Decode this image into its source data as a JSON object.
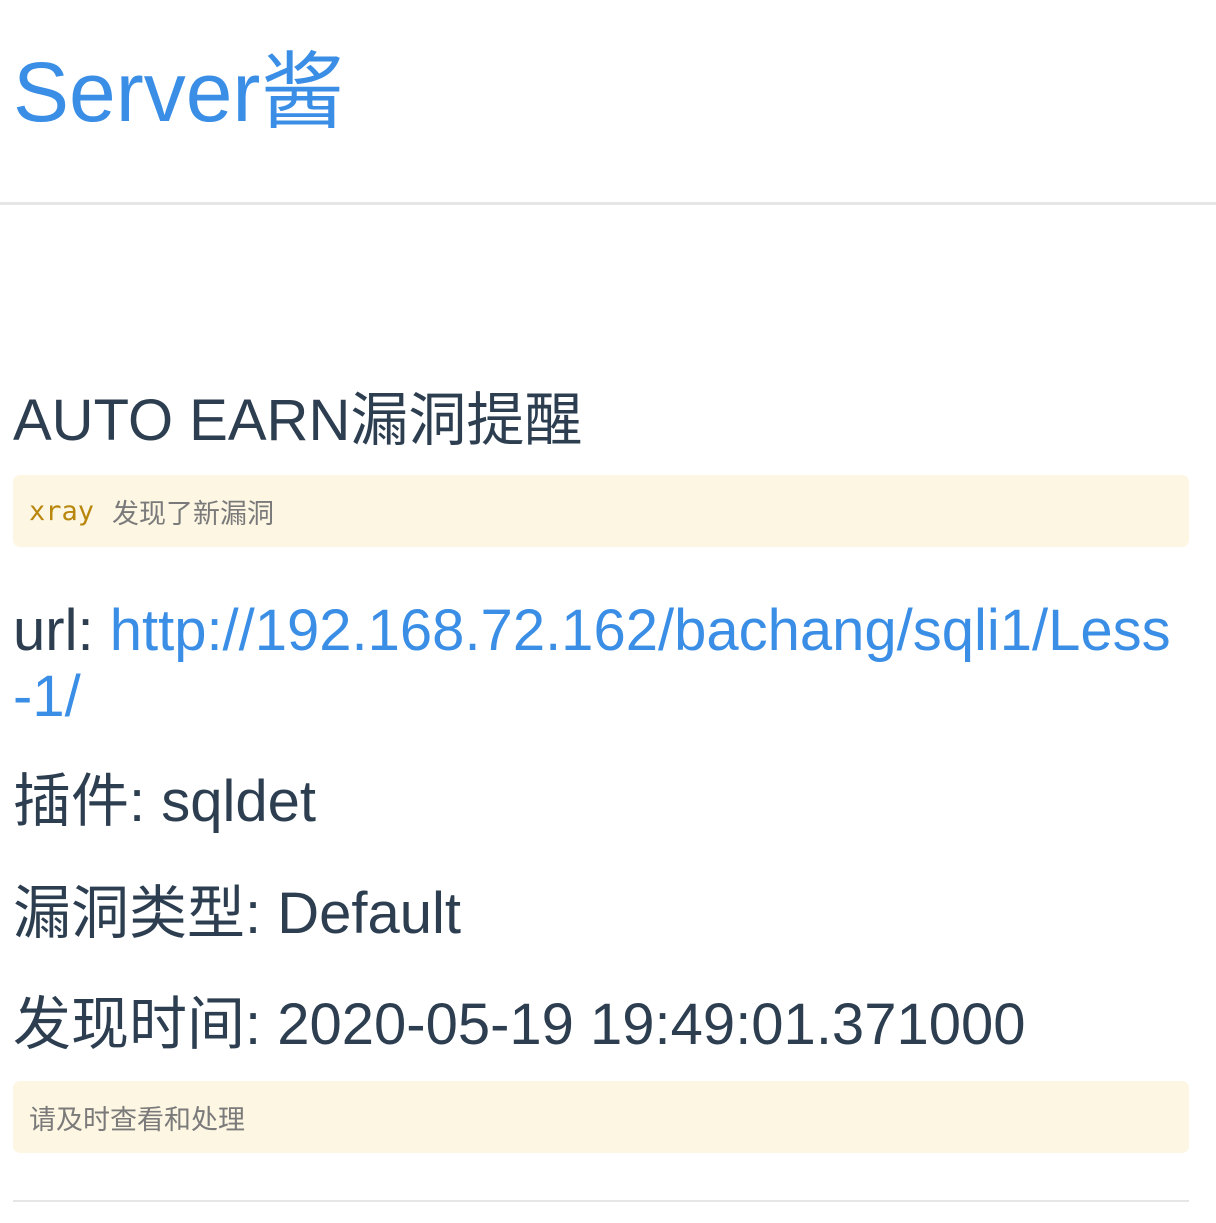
{
  "header": {
    "site_title": "Server酱"
  },
  "notice": {
    "title": "AUTO EARN漏洞提醒",
    "code_tool": "xray",
    "code_text": "发现了新漏洞",
    "url_label": "url:",
    "url_value": "http://192.168.72.162/bachang/sqli1/Less-1/",
    "plugin_label": "插件:",
    "plugin_value": "sqldet",
    "type_label": "漏洞类型:",
    "type_value": "Default",
    "time_label": "发现时间:",
    "time_value": "2020-05-19 19:49:01.371000",
    "footer_note": "请及时查看和处理"
  },
  "colors": {
    "link": "#3a8ee6",
    "text": "#2c3e50",
    "code_bg": "#fdf6e3",
    "code_keyword": "#b8860b"
  }
}
